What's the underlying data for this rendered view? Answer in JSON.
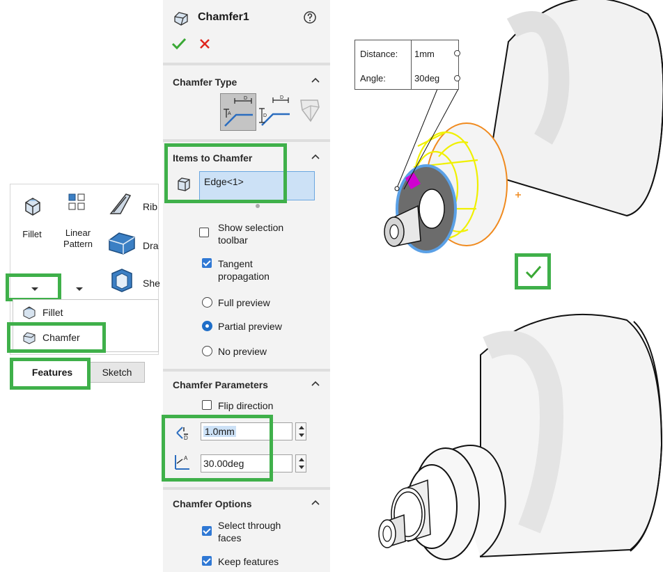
{
  "ribbon": {
    "fillet_label": "Fillet",
    "linear_pattern_label": "Linear Pattern",
    "rib_label": "Rib",
    "draft_label": "Dra",
    "shell_label": "She"
  },
  "fillet_menu": {
    "items": [
      {
        "label": "Fillet",
        "icon": "fillet-icon"
      },
      {
        "label": "Chamfer",
        "icon": "chamfer-icon"
      }
    ]
  },
  "tabs": [
    {
      "label": "Features",
      "active": true
    },
    {
      "label": "Sketch",
      "active": false
    }
  ],
  "property_manager": {
    "title": "Chamfer1",
    "help_icon": "question-circle-icon",
    "ok_icon": "checkmark-icon",
    "cancel_icon": "x-icon",
    "chamfer_type": {
      "title": "Chamfer Type",
      "options": [
        "angle-distance",
        "distance-distance",
        "vertex"
      ],
      "selected": "angle-distance"
    },
    "items_to_chamfer": {
      "title": "Items to Chamfer",
      "selection": "Edge<1>"
    },
    "options": {
      "show_selection_toolbar": {
        "label": "Show selection toolbar",
        "checked": false
      },
      "tangent_propagation": {
        "label": "Tangent propagation",
        "checked": true
      },
      "preview": {
        "choices": [
          "Full preview",
          "Partial preview",
          "No preview"
        ],
        "selected": "Partial preview"
      }
    },
    "chamfer_parameters": {
      "title": "Chamfer Parameters",
      "flip_direction": {
        "label": "Flip direction",
        "checked": false
      },
      "distance_value": "1.0mm",
      "angle_value": "30.00deg"
    },
    "chamfer_options": {
      "title": "Chamfer Options",
      "select_through_faces": {
        "label": "Select through faces",
        "checked": true
      },
      "keep_features": {
        "label": "Keep features",
        "checked": true
      }
    }
  },
  "viewport": {
    "callout": {
      "distance_label": "Distance:",
      "distance_value": "1mm",
      "angle_label": "Angle:",
      "angle_value": "30deg"
    },
    "confirm_icon": "checkmark-icon"
  },
  "colors": {
    "highlight_green": "#3fb04a",
    "selection_blue": "#5aa0e6",
    "preview_yellow": "#f0f000",
    "edge_orange": "#f08a1e",
    "ok_green": "#3aa835",
    "cancel_red": "#e0261e"
  }
}
